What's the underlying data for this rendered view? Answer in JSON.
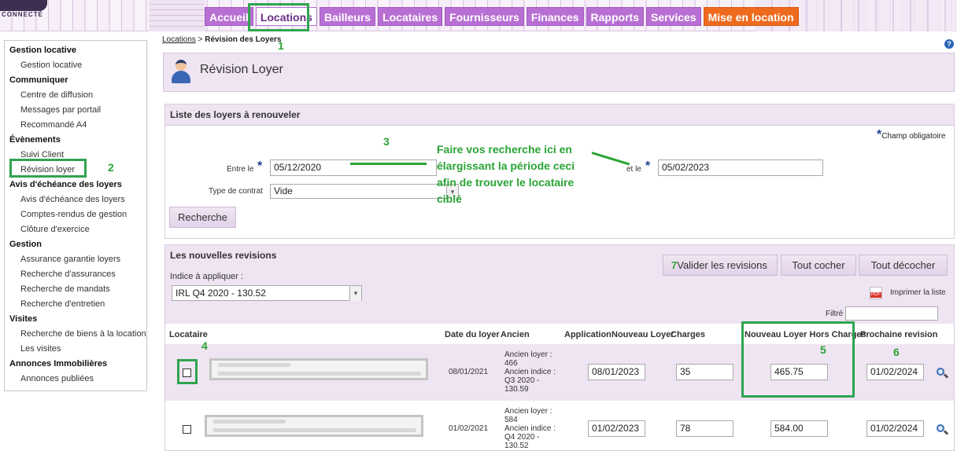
{
  "header": {
    "logo_text": "CONNECTÉ",
    "tabs": [
      {
        "label": "Accueil"
      },
      {
        "label": "Locations"
      },
      {
        "label": "Bailleurs"
      },
      {
        "label": "Locataires"
      },
      {
        "label": "Fournisseurs"
      },
      {
        "label": "Finances"
      },
      {
        "label": "Rapports"
      },
      {
        "label": "Services"
      },
      {
        "label": "Mise en location"
      }
    ]
  },
  "annotations": {
    "n1": "1",
    "n2": "2",
    "n3": "3",
    "n4": "4",
    "n5": "5",
    "n6": "6",
    "n7": "7",
    "note": "Faire vos recherche ici en élargissant la période ceci afin de trouver le locataire ciblé"
  },
  "sidebar": {
    "groups": [
      {
        "title": "Gestion locative",
        "items": [
          "Gestion locative"
        ]
      },
      {
        "title": "Communiquer",
        "items": [
          "Centre de diffusion",
          "Messages par portail",
          "Recommandé A4"
        ]
      },
      {
        "title": "Évènements",
        "items": [
          "Suivi Client",
          "Révision loyer"
        ]
      },
      {
        "title": "Avis d'échéance des loyers",
        "items": [
          "Avis d'échéance des loyers",
          "Comptes-rendus de gestion",
          "Clôture d'exercice"
        ]
      },
      {
        "title": "Gestion",
        "items": [
          "Assurance garantie loyers",
          "Recherche d'assurances",
          "Recherche de mandats",
          "Recherche d'entretien"
        ]
      },
      {
        "title": "Visites",
        "items": [
          "Recherche de biens à la location",
          "Les visites"
        ]
      },
      {
        "title": "Annonces Immobilières",
        "items": [
          "Annonces publiées"
        ]
      }
    ]
  },
  "breadcrumb": {
    "link": "Locations",
    "sep": " > ",
    "current": "Révision des Loyers"
  },
  "help_icon": "?",
  "page_title": "Révision Loyer",
  "search_panel": {
    "title": "Liste des loyers à renouveler",
    "required_note": "Champ obligatoire",
    "from_label": "Entre le",
    "from_value": "05/12/2020",
    "to_label": "et le",
    "to_value": "05/02/2023",
    "contract_label": "Type de contrat",
    "contract_value": "Vide",
    "search_button": "Recherche"
  },
  "revisions_panel": {
    "title": "Les nouvelles revisions",
    "validate_button": "Valider les revisions",
    "check_all_button": "Tout cocher",
    "uncheck_all_button": "Tout décocher",
    "index_label": "Indice à appliquer :",
    "index_value": "IRL Q4 2020 - 130.52",
    "print_label": "Imprimer la liste",
    "filter_label": "Filtré",
    "columns": {
      "tenant": "Locataire",
      "rent_date": "Date du loyer",
      "old": "Ancien",
      "application": "Application",
      "new_rent": "Nouveau Loyer",
      "charges": "Charges",
      "new_rent_excl": "Nouveau Loyer Hors Charges",
      "next_revision": "Prochaine revision"
    },
    "rows": [
      {
        "date": "08/01/2021",
        "old_rent_label": "Ancien loyer :",
        "old_rent": "466",
        "old_index_label": "Ancien indice :",
        "old_index_q": "Q3 2020 -",
        "old_index_v": "130.59",
        "application": "08/01/2023",
        "charges": "35",
        "new_rent_excl": "465.75",
        "next_revision": "01/02/2024"
      },
      {
        "date": "01/02/2021",
        "old_rent_label": "Ancien loyer :",
        "old_rent": "584",
        "old_index_label": "Ancien indice :",
        "old_index_q": "Q4 2020 -",
        "old_index_v": "130.52",
        "application": "01/02/2023",
        "charges": "78",
        "new_rent_excl": "584.00",
        "next_revision": "01/02/2024"
      }
    ]
  }
}
